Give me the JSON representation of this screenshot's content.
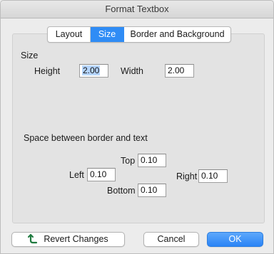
{
  "window": {
    "title": "Format Textbox"
  },
  "tabs": [
    {
      "label": "Layout"
    },
    {
      "label": "Size"
    },
    {
      "label": "Border and Background"
    }
  ],
  "size": {
    "section_label": "Size",
    "height_label": "Height",
    "height_value": "2.00",
    "width_label": "Width",
    "width_value": "2.00"
  },
  "spacing": {
    "section_label": "Space between border and text",
    "top_label": "Top",
    "top_value": "0.10",
    "left_label": "Left",
    "left_value": "0.10",
    "right_label": "Right",
    "right_value": "0.10",
    "bottom_label": "Bottom",
    "bottom_value": "0.10"
  },
  "buttons": {
    "revert": "Revert Changes",
    "cancel": "Cancel",
    "ok": "OK"
  },
  "colors": {
    "accent": "#2f8cf5",
    "selection": "#b5d5fd",
    "revert_icon": "#1f7a3f"
  }
}
